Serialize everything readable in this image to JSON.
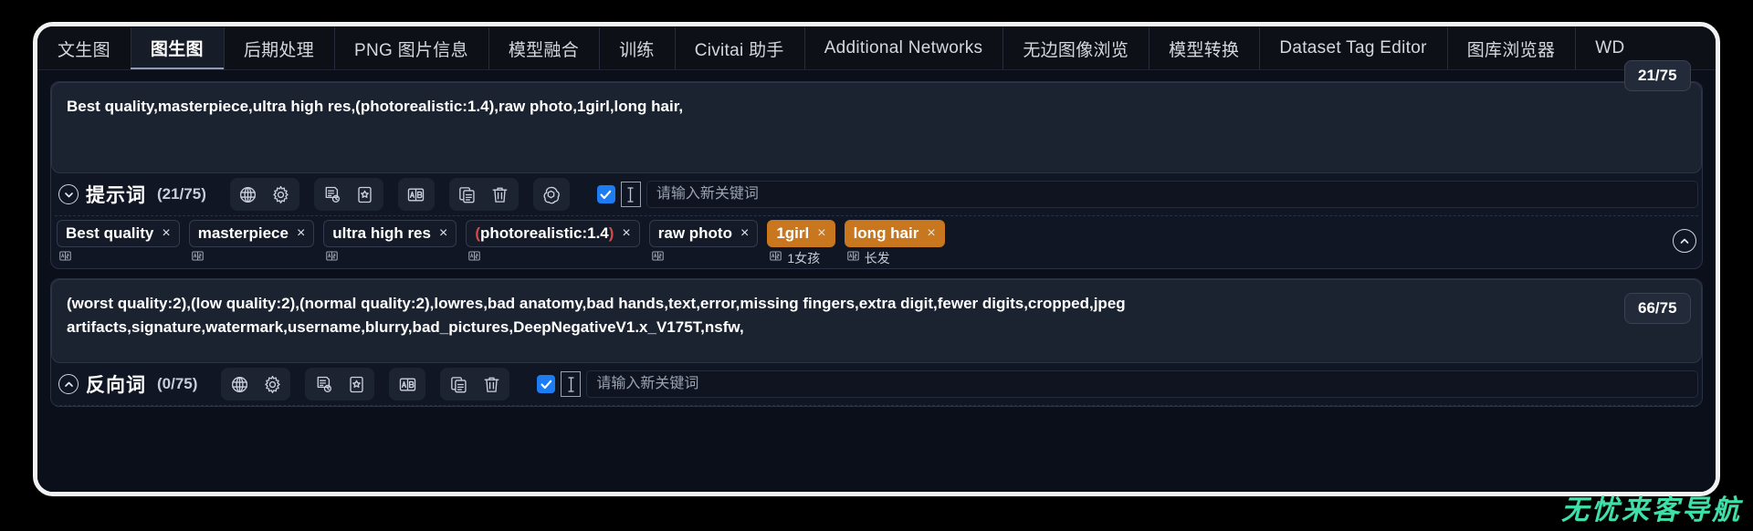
{
  "window": {
    "theme_background": "#0b0f19",
    "frame_border_color": "#f2f2f2",
    "accent_orange": "#c9771f",
    "accent_blue": "#1d7cf2",
    "watermark_color": "#3fe0a8"
  },
  "tabs": [
    {
      "label": "文生图",
      "active": false
    },
    {
      "label": "图生图",
      "active": true
    },
    {
      "label": "后期处理",
      "active": false
    },
    {
      "label": "PNG 图片信息",
      "active": false
    },
    {
      "label": "模型融合",
      "active": false
    },
    {
      "label": "训练",
      "active": false
    },
    {
      "label": "Civitai 助手",
      "active": false
    },
    {
      "label": "Additional Networks",
      "active": false
    },
    {
      "label": "无边图像浏览",
      "active": false
    },
    {
      "label": "模型转换",
      "active": false
    },
    {
      "label": "Dataset Tag Editor",
      "active": false
    },
    {
      "label": "图库浏览器",
      "active": false
    },
    {
      "label": "WD",
      "active": false
    }
  ],
  "positive": {
    "textarea_value": "Best quality,masterpiece,ultra high res,(photorealistic:1.4),raw photo,1girl,long hair,",
    "section_title": "提示词",
    "section_count": "(21/75)",
    "collapse_icon": "chevron-down-icon",
    "badge": "21/75",
    "toolbar_groups": [
      {
        "buttons": [
          {
            "icon": "globe-icon",
            "name": "translate-globe-button"
          },
          {
            "icon": "gear-icon",
            "name": "settings-button"
          }
        ]
      },
      {
        "buttons": [
          {
            "icon": "history-doc-icon",
            "name": "prompt-history-button"
          },
          {
            "icon": "bookmark-star-icon",
            "name": "save-preset-button"
          }
        ]
      },
      {
        "buttons": [
          {
            "icon": "ab-translate-icon",
            "name": "ab-translate-button"
          }
        ]
      },
      {
        "buttons": [
          {
            "icon": "copy-icon",
            "name": "copy-prompt-button"
          },
          {
            "icon": "trash-icon",
            "name": "clear-prompt-button"
          }
        ]
      },
      {
        "buttons": [
          {
            "icon": "openai-spiral-icon",
            "name": "ai-assist-button"
          }
        ]
      }
    ],
    "keyword": {
      "checkbox_checked": true,
      "ibeam_icon": "text-cursor-icon",
      "placeholder": "请输入新关键词",
      "value": ""
    },
    "tags": [
      {
        "text": "Best quality",
        "highlight": false,
        "translation": "",
        "sub_icon": "ab-translate-icon",
        "close": "×"
      },
      {
        "text": "masterpiece",
        "highlight": false,
        "translation": "",
        "sub_icon": "ab-translate-icon",
        "close": "×"
      },
      {
        "text": "ultra high res",
        "highlight": false,
        "translation": "",
        "sub_icon": "ab-translate-icon",
        "close": "×"
      },
      {
        "text": "(photorealistic:1.4)",
        "highlight": false,
        "translation": "",
        "sub_icon": "ab-translate-icon",
        "close": "×"
      },
      {
        "text": "raw photo",
        "highlight": false,
        "translation": "",
        "sub_icon": "ab-translate-icon",
        "close": "×"
      },
      {
        "text": "1girl",
        "highlight": true,
        "translation": "1女孩",
        "sub_icon": "ab-translate-icon",
        "close": "×"
      },
      {
        "text": "long hair",
        "highlight": true,
        "translation": "长发",
        "sub_icon": "ab-translate-icon",
        "close": "×"
      }
    ]
  },
  "negative": {
    "textarea_value": "(worst quality:2),(low quality:2),(normal quality:2),lowres,bad anatomy,bad hands,text,error,missing fingers,extra digit,fewer digits,cropped,jpeg artifacts,signature,watermark,username,blurry,bad_pictures,DeepNegativeV1.x_V175T,nsfw,",
    "section_title": "反向词",
    "section_count": "(0/75)",
    "collapse_icon": "chevron-up-icon",
    "badge": "66/75",
    "toolbar_groups": [
      {
        "buttons": [
          {
            "icon": "globe-icon",
            "name": "translate-globe-button"
          },
          {
            "icon": "gear-icon",
            "name": "settings-button"
          }
        ]
      },
      {
        "buttons": [
          {
            "icon": "history-doc-icon",
            "name": "prompt-history-button"
          },
          {
            "icon": "bookmark-star-icon",
            "name": "save-preset-button"
          }
        ]
      },
      {
        "buttons": [
          {
            "icon": "ab-translate-icon",
            "name": "ab-translate-button"
          }
        ]
      },
      {
        "buttons": [
          {
            "icon": "copy-icon",
            "name": "copy-prompt-button"
          },
          {
            "icon": "trash-icon",
            "name": "clear-prompt-button"
          }
        ]
      }
    ],
    "keyword": {
      "checkbox_checked": true,
      "ibeam_icon": "text-cursor-icon",
      "placeholder": "请输入新关键词",
      "value": ""
    }
  },
  "watermark": {
    "text": "无忧来客导航"
  }
}
